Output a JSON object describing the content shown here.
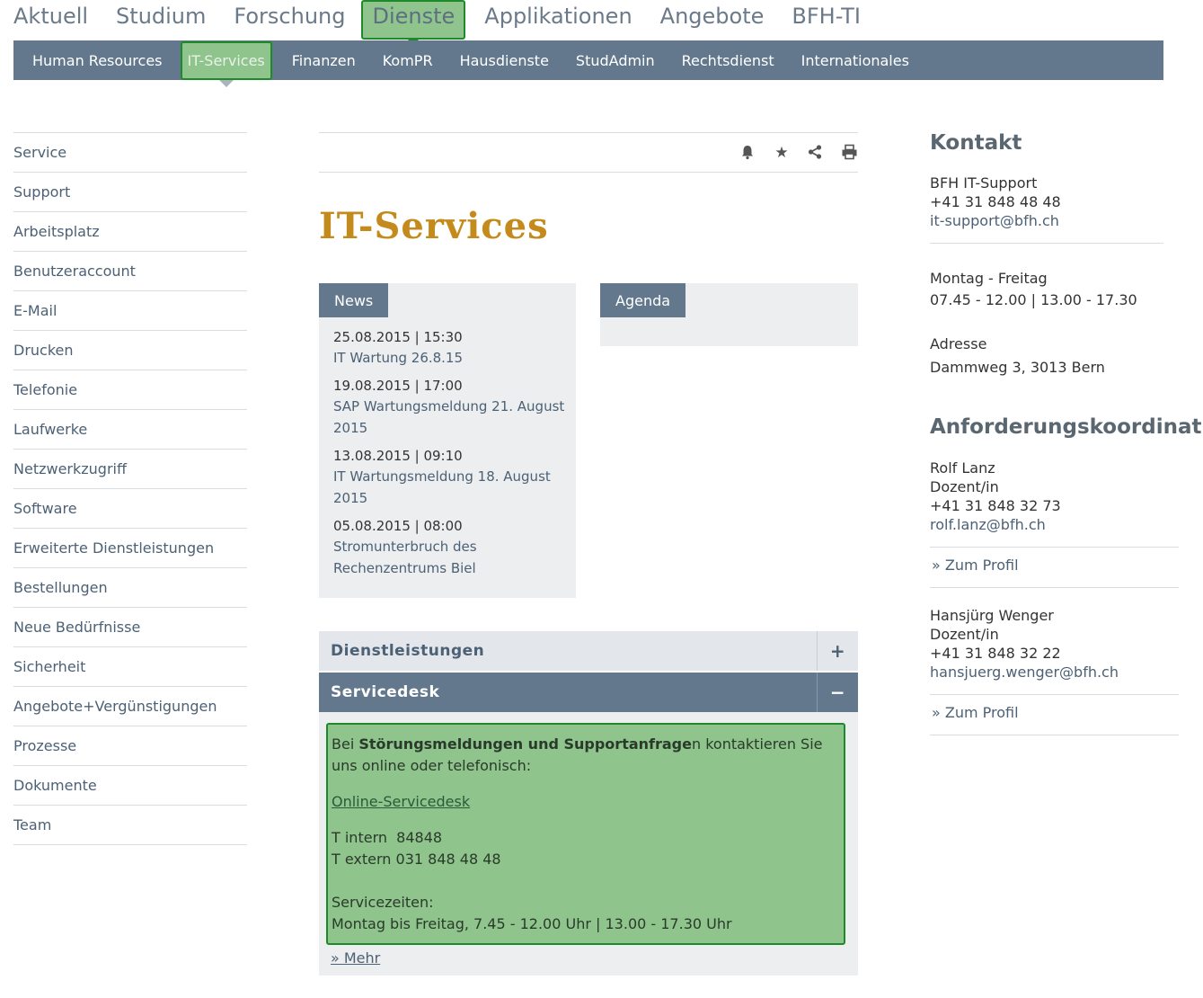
{
  "topnav": [
    "Aktuell",
    "Studium",
    "Forschung",
    "Dienste",
    "Applikationen",
    "Angebote",
    "BFH-TI"
  ],
  "subnav": [
    "Human Resources",
    "IT-Services",
    "Finanzen",
    "KomPR",
    "Hausdienste",
    "StudAdmin",
    "Rechtsdienst",
    "Internationales"
  ],
  "sidebar": [
    "Service",
    "Support",
    "Arbeitsplatz",
    "Benutzeraccount",
    "E-Mail",
    "Drucken",
    "Telefonie",
    "Laufwerke",
    "Netzwerkzugriff",
    "Software",
    "Erweiterte Dienstleistungen",
    "Bestellungen",
    "Neue Bedürfnisse",
    "Sicherheit",
    "Angebote+Vergünstigungen",
    "Prozesse",
    "Dokumente",
    "Team"
  ],
  "toolbar_icons": [
    "bell-icon",
    "star-icon",
    "share-icon",
    "print-icon"
  ],
  "page_title": "IT-Services",
  "news": {
    "tab": "News",
    "items": [
      {
        "date": "25.08.2015 | 15:30",
        "title": "IT Wartung 26.8.15"
      },
      {
        "date": "19.08.2015 | 17:00",
        "title": "SAP Wartungsmeldung 21. August 2015"
      },
      {
        "date": "13.08.2015 | 09:10",
        "title": "IT Wartungsmeldung 18. August 2015"
      },
      {
        "date": "05.08.2015 | 08:00",
        "title": "Stromunterbruch des Rechenzentrums Biel"
      }
    ]
  },
  "agenda": {
    "tab": "Agenda"
  },
  "accordion": {
    "dienstleistungen": {
      "label": "Dienstleistungen",
      "toggle": "+"
    },
    "servicedesk": {
      "label": "Servicedesk",
      "toggle": "−"
    }
  },
  "servicedesk": {
    "intro_pre": "Bei ",
    "intro_bold": "Störungsmeldungen und Supportanfrage",
    "intro_post": "n kontaktieren Sie uns online oder telefonisch:",
    "link": "Online-Servicedesk",
    "t_intern": "T intern  84848",
    "t_extern": "T extern 031 848 48 48",
    "zeiten_label": "Servicezeiten:",
    "zeiten": "Montag bis Freitag, 7.45 - 12.00 Uhr | 13.00 - 17.30 Uhr",
    "mehr": "» Mehr"
  },
  "kontakt": {
    "heading": "Kontakt",
    "name": "BFH IT-Support",
    "phone": "+41 31 848 48 48",
    "email": "it-support@bfh.ch",
    "days": "Montag - Freitag",
    "hours": "07.45 - 12.00 | 13.00 - 17.30",
    "address_label": "Adresse",
    "address": "Dammweg 3, 3013 Bern"
  },
  "anforderung": {
    "heading": "Anforderungskoordination",
    "persons": [
      {
        "name": "Rolf Lanz",
        "role": "Dozent/in",
        "phone": "+41 31 848 32 73",
        "email": "rolf.lanz@bfh.ch",
        "profil": "» Zum Profil"
      },
      {
        "name": "Hansjürg Wenger",
        "role": "Dozent/in",
        "phone": "+41 31 848 32 22",
        "email": "hansjuerg.wenger@bfh.ch",
        "profil": "» Zum Profil"
      }
    ]
  },
  "colors": {
    "accent": "#c48a1b",
    "nav": "#63788d",
    "highlight": "#8fc48d",
    "highlight_border": "#1f8a2a"
  }
}
